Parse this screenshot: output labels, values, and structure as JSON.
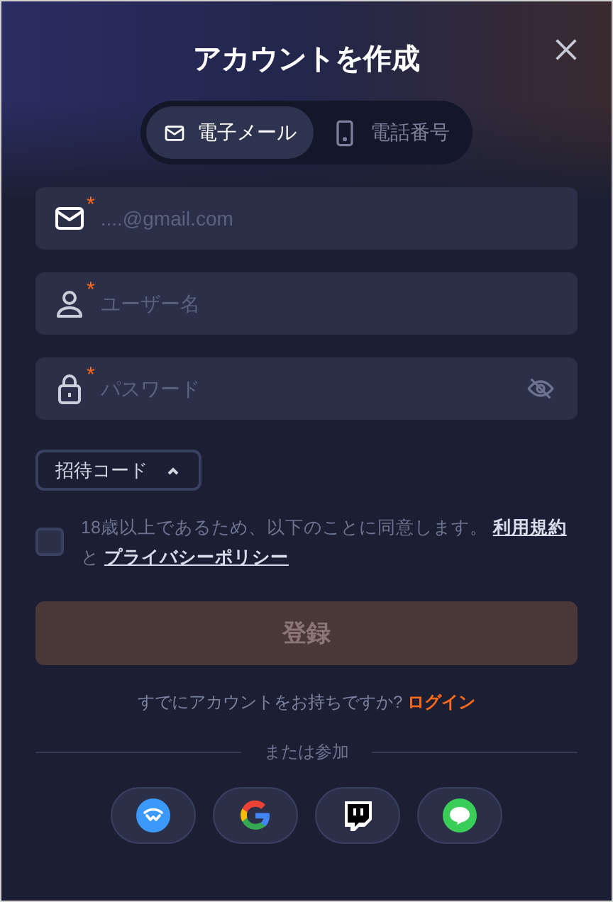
{
  "title": "アカウントを作成",
  "tabs": [
    {
      "label": "電子メール",
      "kind": "email",
      "selected": true
    },
    {
      "label": "電話番号",
      "kind": "phone",
      "selected": false
    }
  ],
  "fields": [
    {
      "kind": "email",
      "placeholder": "....@gmail.com",
      "required_mark": "*"
    },
    {
      "kind": "user",
      "placeholder": "ユーザー名",
      "required_mark": "*"
    },
    {
      "kind": "password",
      "placeholder": "パスワード",
      "required_mark": "*"
    }
  ],
  "invite_code": {
    "label": "招待コード",
    "expanded": true
  },
  "agreement": {
    "checked": false,
    "text": "18歳以上であるため、以下のことに同意します。",
    "terms_link": "利用規約",
    "joiner": "と",
    "privacy_link": "プライバシーポリシー"
  },
  "submit": {
    "label": "登録",
    "disabled": true
  },
  "login_prompt": {
    "text": "すでにアカウントをお持ちですか?",
    "link": "ログイン"
  },
  "divider_label": "または参加",
  "social": [
    {
      "kind": "wave"
    },
    {
      "kind": "g"
    },
    {
      "kind": "square_bubble"
    },
    {
      "kind": "round_bubble"
    }
  ]
}
